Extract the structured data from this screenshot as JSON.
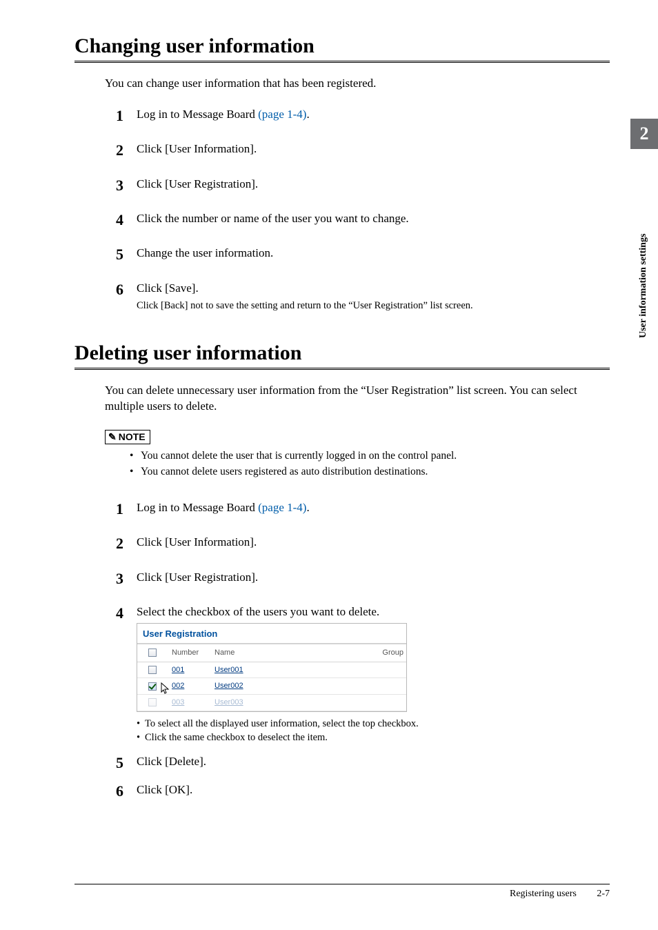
{
  "sidebar": {
    "chapter_number": "2",
    "chapter_label": "User information settings"
  },
  "section1": {
    "title": "Changing user information",
    "intro": "You can change user information that has been registered.",
    "steps": [
      {
        "num": "1",
        "text_pre": "Log in to Message Board ",
        "link": "(page 1-4)",
        "text_post": "."
      },
      {
        "num": "2",
        "text": "Click [User Information]."
      },
      {
        "num": "3",
        "text": "Click [User Registration]."
      },
      {
        "num": "4",
        "text": "Click the number or name of the user you want to change."
      },
      {
        "num": "5",
        "text": "Change the user information."
      },
      {
        "num": "6",
        "text": "Click [Save].",
        "sub": "Click [Back] not to save the setting and return to the “User Registration” list screen."
      }
    ]
  },
  "section2": {
    "title": "Deleting user information",
    "intro": "You can delete unnecessary user information from the “User Registration” list screen. You can select multiple users to delete.",
    "note_label": "NOTE",
    "notes": [
      "You cannot delete the user that is currently logged in on the control panel.",
      "You cannot delete users registered as auto distribution destinations."
    ],
    "steps": [
      {
        "num": "1",
        "text_pre": "Log in to Message Board ",
        "link": "(page 1-4)",
        "text_post": "."
      },
      {
        "num": "2",
        "text": "Click [User Information]."
      },
      {
        "num": "3",
        "text": "Click [User Registration]."
      },
      {
        "num": "4",
        "text": "Select the checkbox of the users you want to delete."
      },
      {
        "num": "5",
        "text": "Click [Delete]."
      },
      {
        "num": "6",
        "text": "Click [OK]."
      }
    ],
    "screenshot": {
      "title": "User Registration",
      "headers": {
        "number": "Number",
        "name": "Name",
        "group": "Group"
      },
      "rows": [
        {
          "checked": false,
          "number": "001",
          "name": "User001"
        },
        {
          "checked": true,
          "number": "002",
          "name": "User002"
        },
        {
          "checked": false,
          "number": "003",
          "name": "User003"
        }
      ],
      "bullets": [
        "To select all the displayed user information, select the top checkbox.",
        "Click the same checkbox to deselect the item."
      ]
    }
  },
  "footer": {
    "section_name": "Registering users",
    "page": "2-7"
  }
}
